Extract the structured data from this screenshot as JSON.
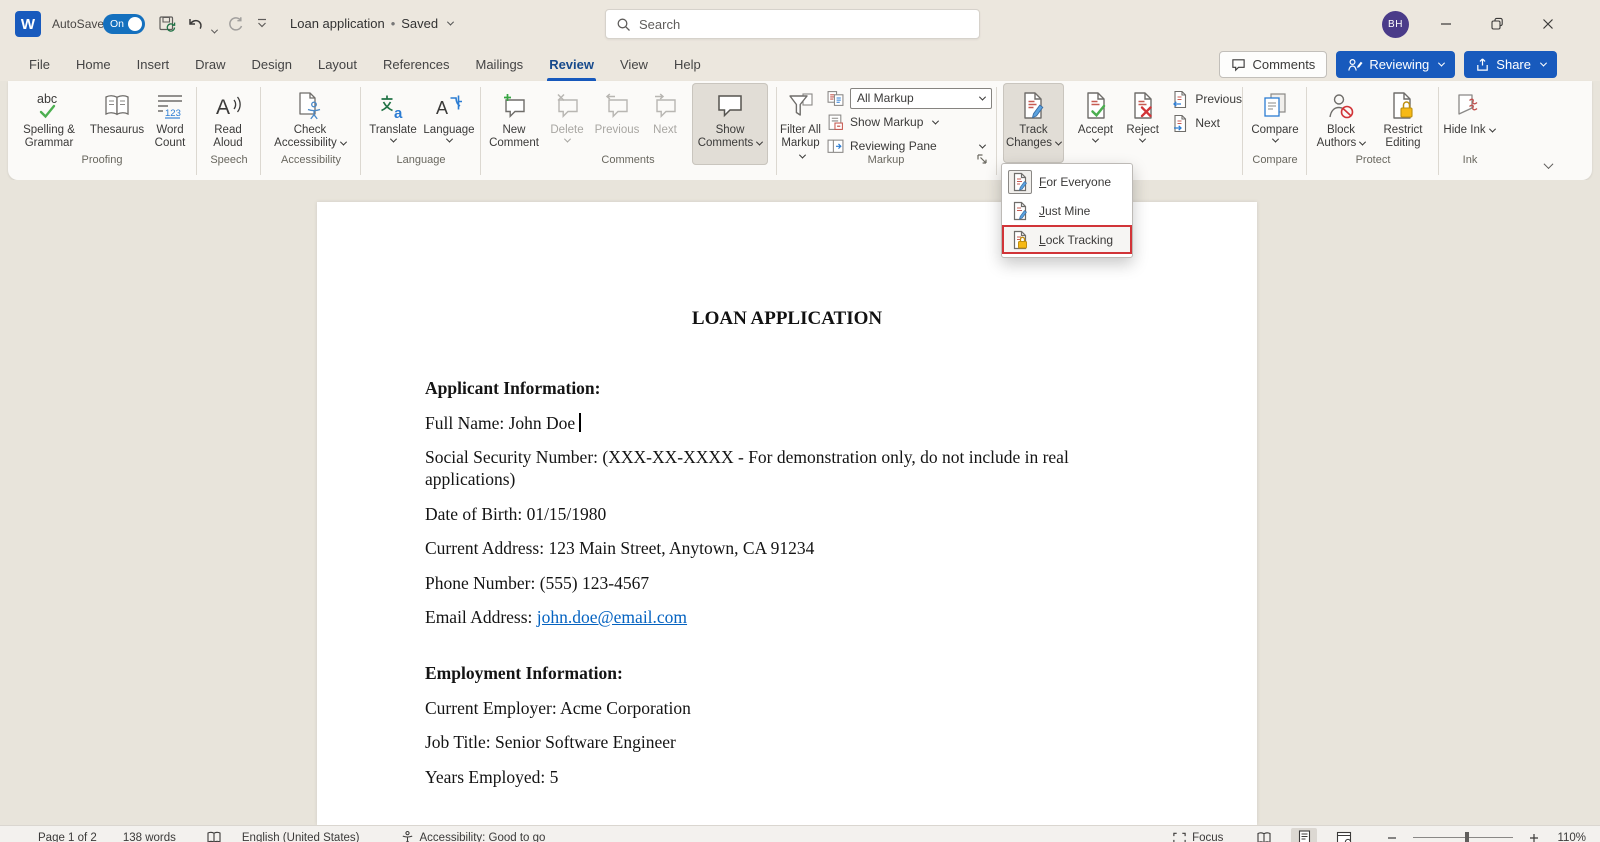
{
  "titlebar": {
    "autosave_label": "AutoSave",
    "autosave_state": "On",
    "doc_title": "Loan application",
    "separator": "•",
    "doc_status": "Saved",
    "search_placeholder": "Search",
    "avatar_initials": "BH"
  },
  "tabs": {
    "items": [
      "File",
      "Home",
      "Insert",
      "Draw",
      "Design",
      "Layout",
      "References",
      "Mailings",
      "Review",
      "View",
      "Help"
    ],
    "active": "Review"
  },
  "top_actions": {
    "comments": "Comments",
    "reviewing": "Reviewing",
    "share": "Share"
  },
  "ribbon": {
    "proofing": {
      "label": "Proofing",
      "spelling": "Spelling & Grammar",
      "thesaurus": "Thesaurus",
      "word_count": "Word Count"
    },
    "speech": {
      "label": "Speech",
      "read_aloud": "Read Aloud"
    },
    "accessibility": {
      "label": "Accessibility",
      "check": "Check Accessibility"
    },
    "language": {
      "label": "Language",
      "translate": "Translate",
      "language": "Language"
    },
    "comments": {
      "label": "Comments",
      "new": "New Comment",
      "delete": "Delete",
      "previous": "Previous",
      "next": "Next",
      "show": "Show Comments"
    },
    "markup": {
      "label": "Markup",
      "filter": "Filter All Markup",
      "all_markup": "All Markup",
      "show_markup": "Show Markup",
      "reviewing_pane": "Reviewing Pane"
    },
    "tracking": {
      "track_changes": "Track Changes"
    },
    "changes": {
      "accept": "Accept",
      "reject": "Reject",
      "previous": "Previous",
      "next": "Next"
    },
    "compare": {
      "label": "Compare",
      "compare": "Compare"
    },
    "protect": {
      "label": "Protect",
      "block_authors": "Block Authors",
      "restrict_editing": "Restrict Editing"
    },
    "ink": {
      "label": "Ink",
      "hide_ink": "Hide Ink"
    }
  },
  "track_menu": {
    "items": [
      {
        "label": "For Everyone",
        "first": "F",
        "rest": "or Everyone",
        "selected": true
      },
      {
        "label": "Just Mine",
        "first": "J",
        "rest": "ust Mine",
        "selected": false
      },
      {
        "label": "Lock Tracking",
        "first": "L",
        "rest": "ock Tracking",
        "selected": false,
        "annotated": true
      }
    ]
  },
  "document": {
    "title": "LOAN APPLICATION",
    "heading1": "Applicant Information:",
    "full_name": "Full Name: John Doe",
    "ssn": "Social Security Number: (XXX-XX-XXXX - For demonstration only, do not include in real applications)",
    "dob": "Date of Birth: 01/15/1980",
    "address": "Current Address: 123 Main Street, Anytown, CA 91234",
    "phone": "Phone Number: (555) 123-4567",
    "email_label": "Email Address: ",
    "email_link": "john.doe@email.com",
    "heading2": "Employment Information:",
    "employer": "Current Employer: Acme Corporation",
    "job_title": "Job Title: Senior Software Engineer",
    "years": "Years Employed: 5"
  },
  "statusbar": {
    "page": "Page 1 of 2",
    "words": "138 words",
    "language": "English (United States)",
    "accessibility": "Accessibility: Good to go",
    "focus": "Focus",
    "zoom_level": "110%"
  },
  "colors": {
    "accent_blue": "#185abd",
    "annotation_red": "#d13438",
    "avatar_purple": "#4a3b89",
    "link_blue": "#0563c1",
    "chrome_beige": "#ece7de"
  },
  "icons": {
    "search": "magnifier",
    "autosave_toggle": "switch-on",
    "save": "disk-with-sync-arrows",
    "undo": "arrow-curl-left",
    "redo": "arrow-circle",
    "track_changes": "document-with-pencil",
    "lock_tracking": "document-with-lock",
    "accept": "document-with-green-check",
    "reject": "document-with-red-x",
    "comments": "speech-bubble",
    "filter_markup": "funnel",
    "block_authors": "person-with-no-symbol",
    "restrict_editing": "document-with-lock",
    "hide_ink": "page-with-red-squiggle",
    "window": "minimize-restore-close"
  }
}
